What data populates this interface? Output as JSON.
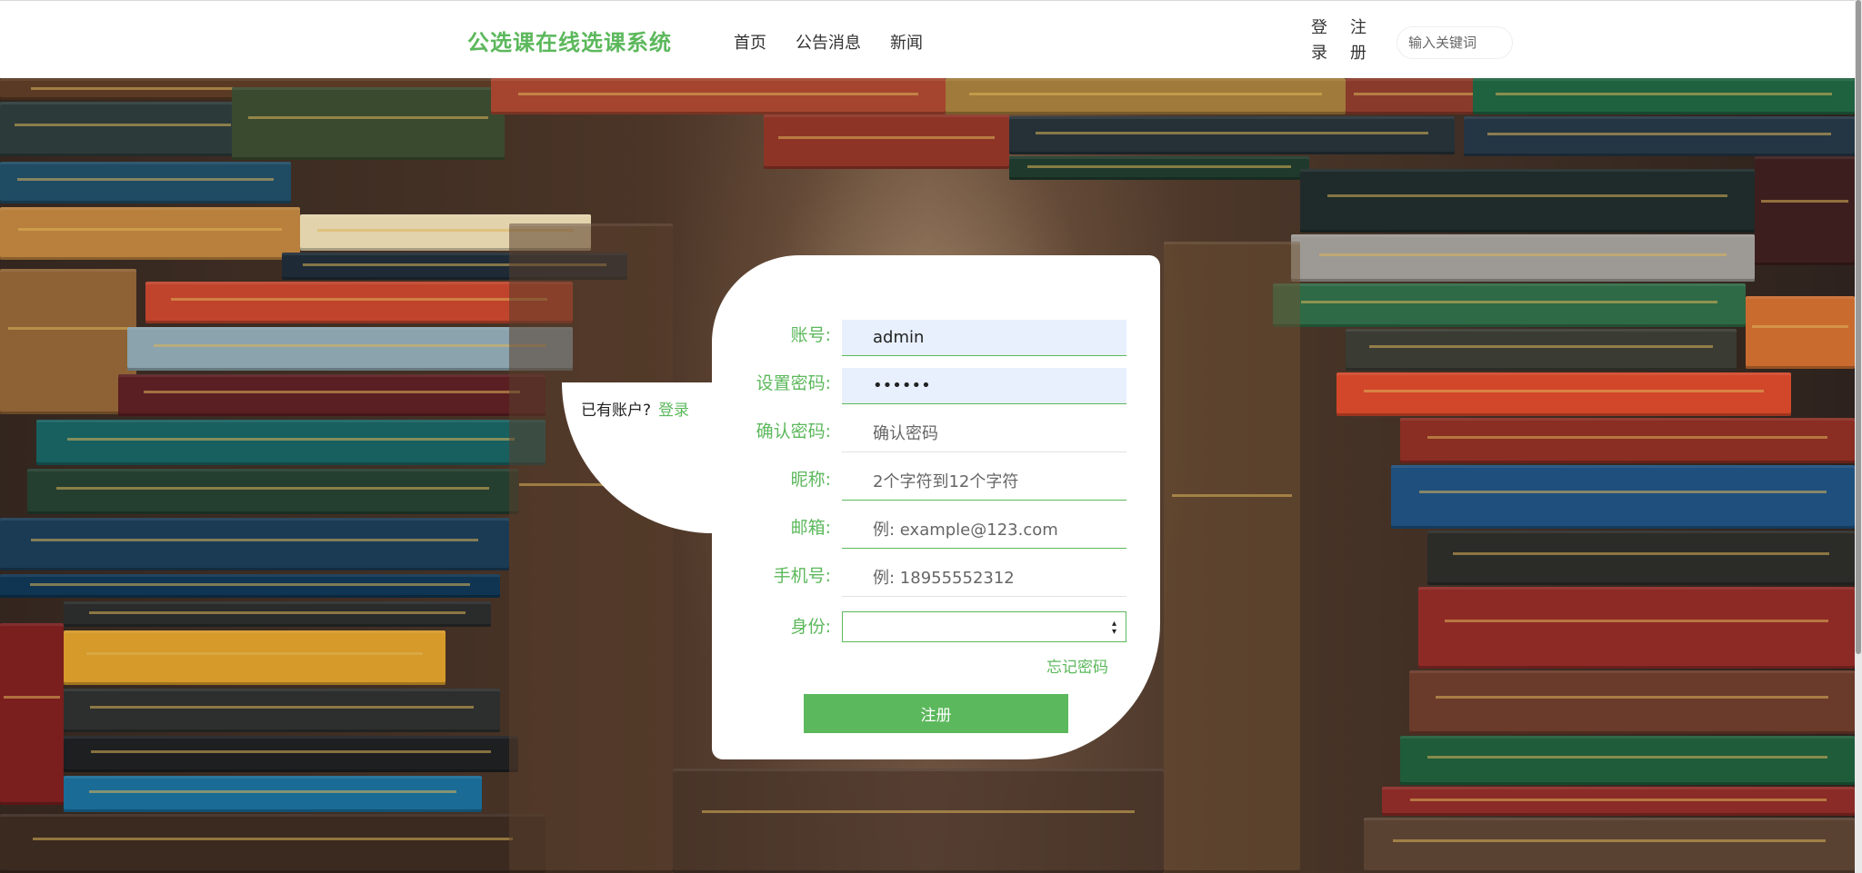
{
  "header": {
    "brand": "公选课在线选课系统",
    "nav": [
      "首页",
      "公告消息",
      "新闻"
    ],
    "login": "登录",
    "register": "注册",
    "search_placeholder": "输入关键词"
  },
  "side": {
    "have_account": "已有账户?",
    "login_link": "登录"
  },
  "form": {
    "fields": [
      {
        "label": "账号:",
        "value": "admin",
        "placeholder": ""
      },
      {
        "label": "设置密码:",
        "value": "••••••",
        "placeholder": ""
      },
      {
        "label": "确认密码:",
        "value": "",
        "placeholder": "确认密码"
      },
      {
        "label": "昵称:",
        "value": "",
        "placeholder": "2个字符到12个字符"
      },
      {
        "label": "邮箱:",
        "value": "",
        "placeholder": "例: example@123.com"
      },
      {
        "label": "手机号:",
        "value": "",
        "placeholder": "例: 18955552312"
      }
    ],
    "role_label": "身份:",
    "role_value": "",
    "forgot": "忘记密码",
    "submit": "注册"
  },
  "colors": {
    "accent": "#5cb85c",
    "autofill": "#e8f0fe"
  }
}
